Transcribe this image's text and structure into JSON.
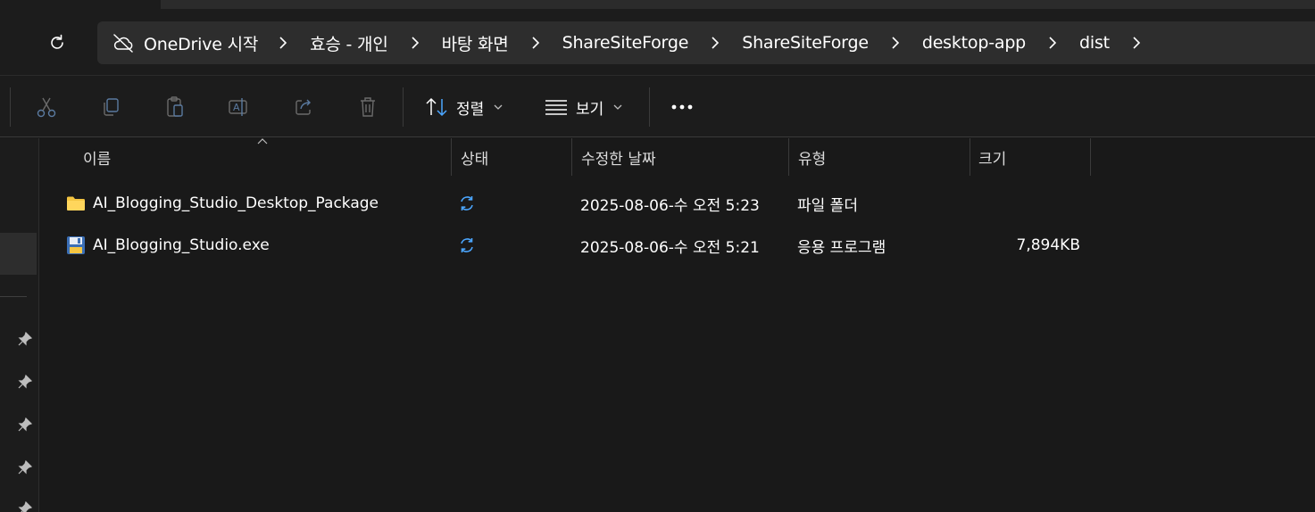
{
  "address": {
    "root_label": "OneDrive 시작",
    "crumbs": [
      "효승 - 개인",
      "바탕 화면",
      "ShareSiteForge",
      "ShareSiteForge",
      "desktop-app",
      "dist"
    ]
  },
  "toolbar": {
    "sort_label": "정렬",
    "view_label": "보기"
  },
  "columns": {
    "name": "이름",
    "status": "상태",
    "modified": "수정한 날짜",
    "type": "유형",
    "size": "크기"
  },
  "files": [
    {
      "name": "AI_Blogging_Studio_Desktop_Package",
      "modified": "2025-08-06-수 오전 5:23",
      "type": "파일 폴더",
      "size": "",
      "icon": "folder-icon"
    },
    {
      "name": "AI_Blogging_Studio.exe",
      "modified": "2025-08-06-수 오전 5:21",
      "type": "응용 프로그램",
      "size": "7,894KB",
      "icon": "exe-file-icon"
    }
  ],
  "colors": {
    "background": "#191919",
    "chrome": "#1c1c1c",
    "address_bar": "#2d2d2d",
    "sync_blue": "#4ba6ff",
    "folder_yellow": "#f4c542"
  }
}
